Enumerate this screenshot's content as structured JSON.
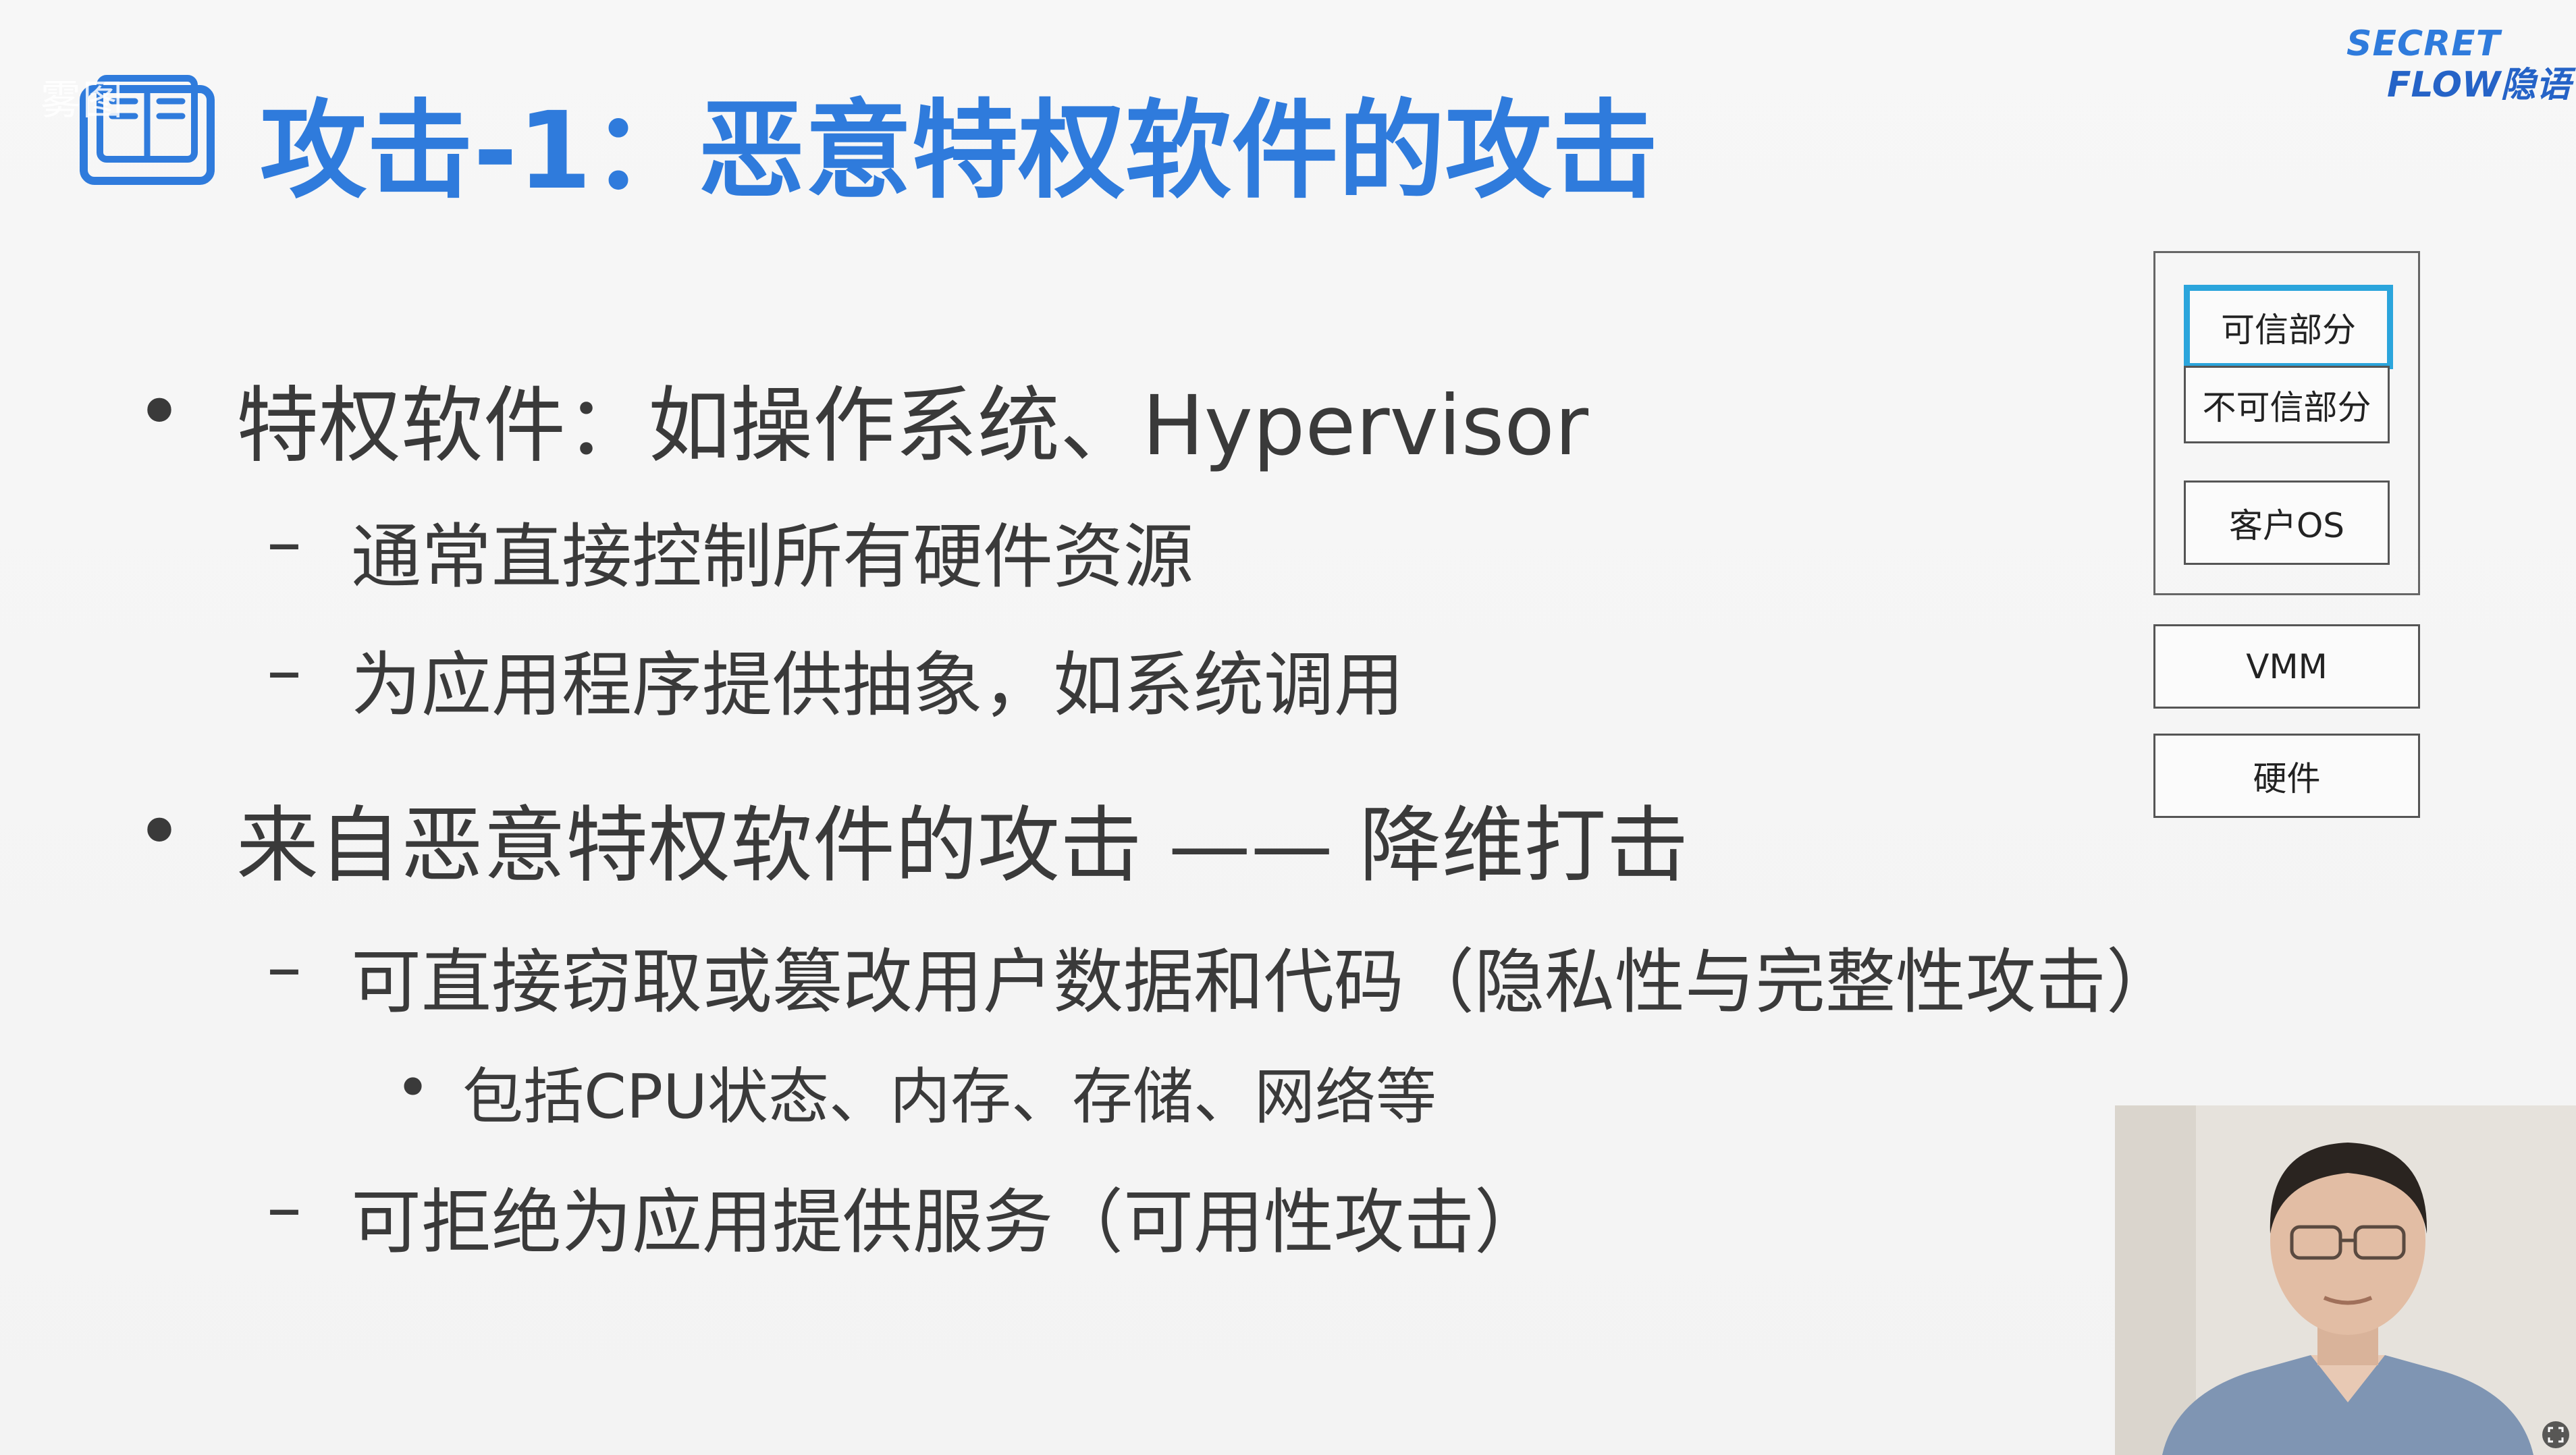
{
  "header": {
    "title": "攻击-1：恶意特权软件的攻击",
    "watermark": "雾图"
  },
  "logo": {
    "line1": "SECRET",
    "line2": "FLOW隐语"
  },
  "bullets": {
    "b1": {
      "text": "特权软件：如操作系统、Hypervisor",
      "subs": [
        "通常直接控制所有硬件资源",
        "为应用程序提供抽象，如系统调用"
      ]
    },
    "b2": {
      "text": "来自恶意特权软件的攻击 —— 降维打击",
      "sub1": "可直接窃取或篡改用户数据和代码（隐私性与完整性攻击）",
      "sub1_detail": "包括CPU状态、内存、存储、网络等",
      "sub2": "可拒绝为应用提供服务（可用性攻击）"
    },
    "dot": "•",
    "dash": "–"
  },
  "diagram": {
    "trusted": "可信部分",
    "untrusted": "不可信部分",
    "guest_os": "客户OS",
    "vmm": "VMM",
    "hardware": "硬件"
  },
  "colors": {
    "title": "#2f7bdc",
    "body_text": "#3a3a3a",
    "trusted_border": "#2ba5dc",
    "background": "#f5f5f5"
  }
}
